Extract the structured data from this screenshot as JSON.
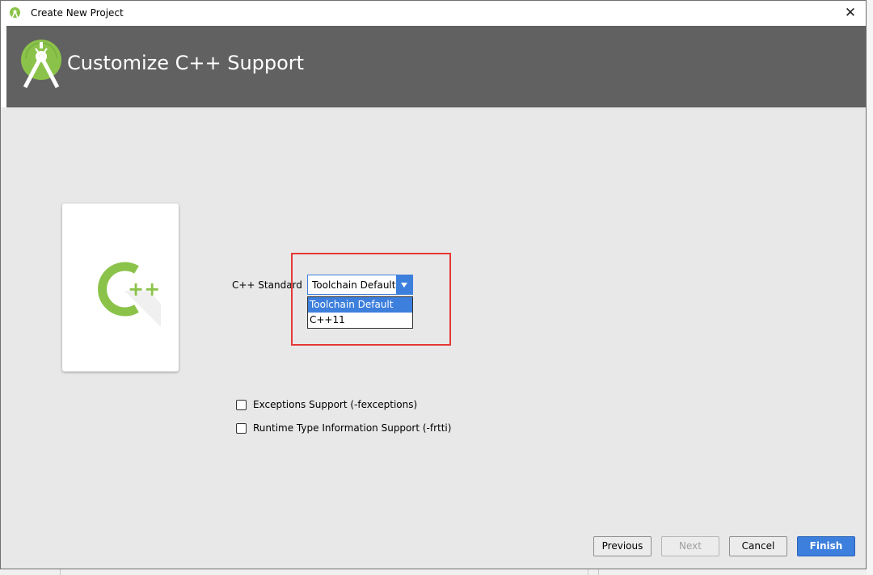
{
  "window": {
    "title": "Create New Project",
    "close_glyph": "✕"
  },
  "banner": {
    "heading": "Customize C++ Support",
    "icon": "android-studio-logo"
  },
  "card": {
    "icon": "cpp-logo",
    "logo_text": "++"
  },
  "form": {
    "cpp_standard_label": "C++ Standard",
    "cpp_standard_value": "Toolchain Default",
    "cpp_standard_options": [
      "Toolchain Default",
      "C++11"
    ],
    "exceptions_label": "Exceptions Support (-fexceptions)",
    "exceptions_checked": false,
    "rtti_label": "Runtime Type Information Support (-frtti)",
    "rtti_checked": false
  },
  "buttons": {
    "previous": "Previous",
    "next": "Next",
    "cancel": "Cancel",
    "finish": "Finish"
  },
  "colors": {
    "banner": "#616161",
    "accent": "#3d7fdc",
    "highlight": "#e53935",
    "android_green": "#8bc34a"
  }
}
